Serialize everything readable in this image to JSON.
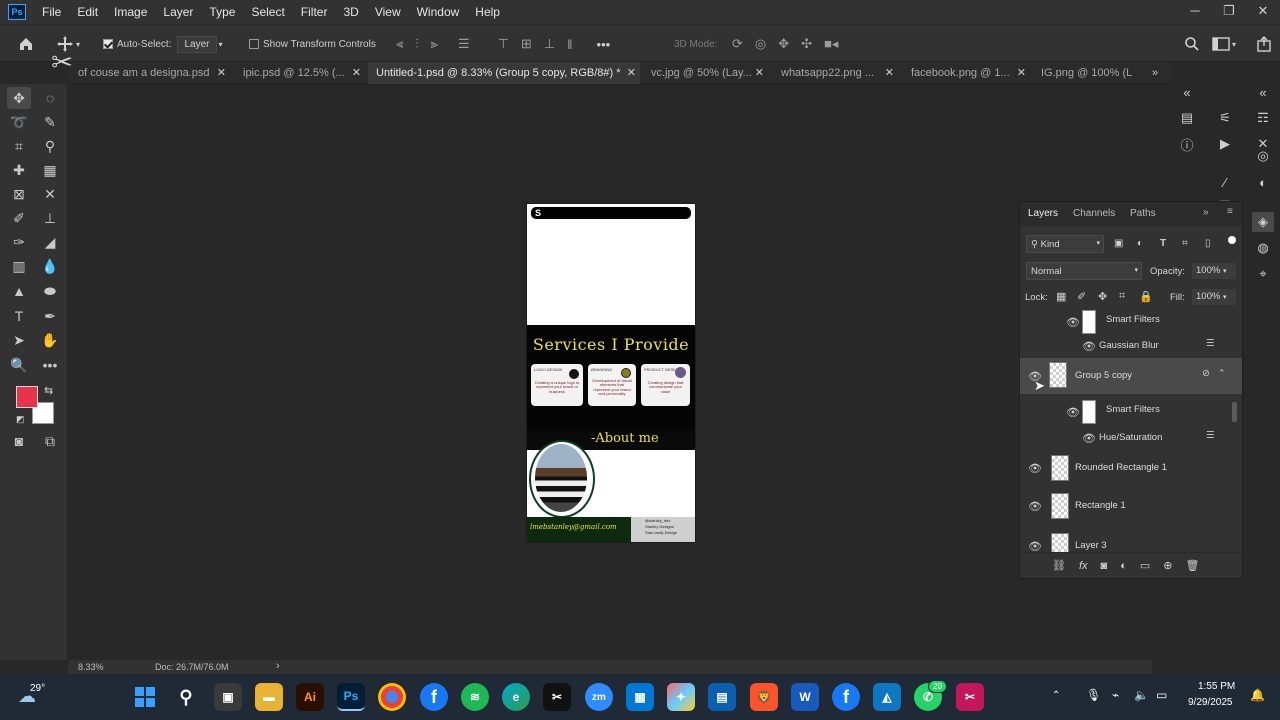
{
  "app": {
    "logo": "Ps",
    "menu": [
      "File",
      "Edit",
      "Image",
      "Layer",
      "Type",
      "Select",
      "Filter",
      "3D",
      "View",
      "Window",
      "Help"
    ]
  },
  "window_controls": {
    "minimize": "─",
    "maximize": "❐",
    "close": "✕"
  },
  "options_bar": {
    "auto_select_label": "Auto-Select:",
    "auto_select_target": "Layer",
    "show_transform_label": "Show Transform Controls",
    "mode_3d_label": "3D Mode:"
  },
  "tabs": [
    {
      "label": "of couse am a designa.psd"
    },
    {
      "label": "ipic.psd @ 12.5% (..."
    },
    {
      "label": "Untitled-1.psd @ 8.33% (Group 5 copy, RGB/8#) *"
    },
    {
      "label": "vc.jpg @ 50% (Lay..."
    },
    {
      "label": "whatsapp22.png ..."
    },
    {
      "label": "facebook.png @ 1..."
    },
    {
      "label": "IG.png @ 100% (L"
    }
  ],
  "tab_close": "✕",
  "status": {
    "zoom": "8.33%",
    "doc": "Doc: 26.7M/76.0M",
    "arrow": "›"
  },
  "artwork": {
    "services_title": "Services I Provide",
    "card1_title": "LOGO DESIGN",
    "card1_text": "Creating a unique logo to represent your brand or business",
    "card2_title": "BRANDING",
    "card2_text": "Development of visual elements that represent your brand and personality",
    "card3_title": "PRODUCT DESIGN",
    "card3_text": "Creating design that communicate your value",
    "about_title": "-About me",
    "email": "lmebstanley@gmail.com",
    "social1": "@stanley_dev",
    "social2": "Stanley Designs",
    "social3": "Stan lastly Design"
  },
  "layers_panel": {
    "tabs": [
      "Layers",
      "Channels",
      "Paths"
    ],
    "kind_label": "Kind",
    "blend_mode": "Normal",
    "opacity_label": "Opacity:",
    "opacity_value": "100%",
    "lock_label": "Lock:",
    "fill_label": "Fill:",
    "fill_value": "100%",
    "rows": [
      {
        "name": "Smart Filters",
        "kind": "filters"
      },
      {
        "name": "Gaussian Blur",
        "kind": "filter"
      },
      {
        "name": "Group 5 copy",
        "kind": "layer",
        "selected": true
      },
      {
        "name": "Smart Filters",
        "kind": "filters"
      },
      {
        "name": "Hue/Saturation",
        "kind": "filter"
      },
      {
        "name": "Rounded Rectangle 1",
        "kind": "layer"
      },
      {
        "name": "Rectangle 1",
        "kind": "layer"
      },
      {
        "name": "Layer 3",
        "kind": "layer"
      }
    ]
  },
  "taskbar": {
    "weather": "29°",
    "time": "1:55 PM",
    "date": "9/29/2025",
    "whatsapp_badge": "20",
    "apps": [
      "start",
      "search",
      "files",
      "explorer",
      "illustrator",
      "photoshop",
      "chrome",
      "facebook",
      "spotify",
      "edge",
      "capcut",
      "zoom",
      "store",
      "copilot",
      "movies",
      "brave",
      "word",
      "facebook2",
      "photos",
      "whatsapp",
      "snip"
    ]
  },
  "colors": {
    "accent": "#31a8ff",
    "foreground": "#e8334a",
    "background": "#ffffff",
    "services_yellow": "#e8e04a"
  }
}
